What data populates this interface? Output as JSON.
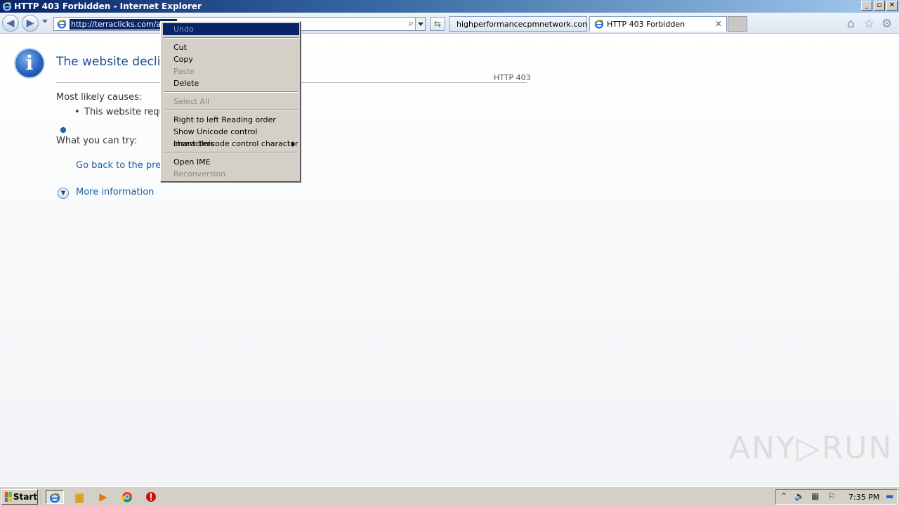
{
  "window": {
    "title": "HTTP 403 Forbidden - Internet Explorer",
    "controls": [
      "_",
      "▫",
      "✕"
    ]
  },
  "toolbar": {
    "url": "http://terraclicks.com/anon",
    "tabs": [
      {
        "label": "highperformancecpmnetwork.com",
        "active": false
      },
      {
        "label": "HTTP 403 Forbidden",
        "active": true
      }
    ]
  },
  "page": {
    "heading": "The website decline",
    "http_code": "HTTP 403",
    "causes_label": "Most likely causes:",
    "cause_item": "This website requ",
    "try_label": "What you can try:",
    "go_back_link": "Go back to the pre",
    "more_info_link": "More information"
  },
  "context_menu": {
    "items": [
      {
        "label": "Undo",
        "disabled": true,
        "highlight": true
      },
      {
        "label": "Cut",
        "disabled": false
      },
      {
        "label": "Copy",
        "disabled": false
      },
      {
        "label": "Paste",
        "disabled": true
      },
      {
        "label": "Delete",
        "disabled": false
      },
      {
        "label": "Select All",
        "disabled": true
      },
      {
        "label": "Right to left Reading order",
        "disabled": false
      },
      {
        "label": "Show Unicode control characters",
        "disabled": false
      },
      {
        "label": "Insert Unicode control character",
        "disabled": false,
        "submenu": true
      },
      {
        "label": "Open IME",
        "disabled": false
      },
      {
        "label": "Reconversion",
        "disabled": true
      }
    ]
  },
  "watermark": "ANY▷RUN",
  "taskbar": {
    "start_label": "Start",
    "clock": "7:35 PM"
  },
  "colors": {
    "link": "#1f5fa8",
    "heading": "#1f4e96",
    "menu_highlight": "#0a246a"
  }
}
